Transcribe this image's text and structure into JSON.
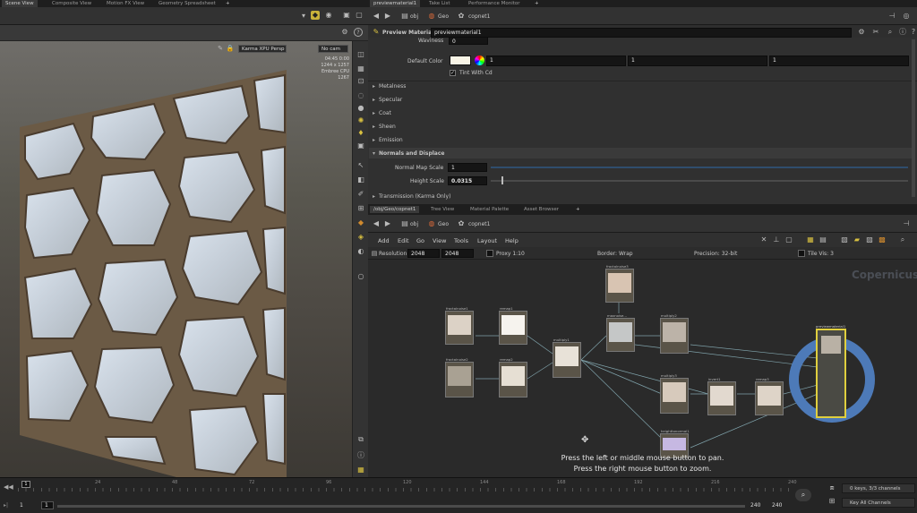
{
  "top_tabs": [
    "Scene View",
    "Composite View",
    "Motion FX View",
    "Geometry Spreadsheet"
  ],
  "viewport": {
    "camera": "Karma XPU Persp",
    "cam_menu": "No cam",
    "stats": [
      "04:45",
      "0:00",
      "1244 x 1257",
      "Embree CPU",
      "1267"
    ]
  },
  "right_top_tabs": [
    "previewmaterial1",
    "Take List",
    "Performance Monitor"
  ],
  "path_top": {
    "root": "obj",
    "geo": "Geo",
    "net": "copnet1"
  },
  "material": {
    "title": "Preview Material",
    "name": "previewmaterial1",
    "waviness_label": "Waviness",
    "waviness": "0",
    "default_color_label": "Default Color",
    "color_values": [
      "1",
      "1",
      "1"
    ],
    "tint_label": "Tint With Cd",
    "sections": [
      "Metalness",
      "Specular",
      "Coat",
      "Sheen",
      "Emission"
    ],
    "normals_section": "Normals and Displace",
    "normal_map_label": "Normal Map Scale",
    "normal_map": "1",
    "height_label": "Height Scale",
    "height": "0.0315",
    "transmission": "Transmission (Karma Only)"
  },
  "net_tabs": [
    "/obj/Geo/copnet1",
    "Tree View",
    "Material Palette",
    "Asset Browser"
  ],
  "path_bottom": {
    "root": "obj",
    "geo": "Geo",
    "net": "copnet1"
  },
  "menu": [
    "Add",
    "Edit",
    "Go",
    "View",
    "Tools",
    "Layout",
    "Help"
  ],
  "res": {
    "label": "Resolution",
    "w": "2048",
    "h": "2048",
    "proxy": "Proxy 1:10",
    "border": "Border: Wrap",
    "precision": "Precision: 32-bit",
    "tile": "Tile Vis: 3"
  },
  "brand": "Copernicus",
  "nodes": {
    "fractalnoise1": "fractalnoise1",
    "fractalnoise2": "fractalnoise2",
    "remap1": "remap1",
    "remap2": "remap2",
    "multiply1": "multiply1",
    "fractalnoise3": "fractalnoise3",
    "maxnoise": "maxnoise...",
    "multiply2": "multiply2",
    "multiply3": "multiply3",
    "invert1": "invert1",
    "remap3": "remap3",
    "heightnormal": "heighttonormal1",
    "output": "previewmaterial1"
  },
  "hint1": "Press the left or middle mouse button to pan.",
  "hint2": "Press the right mouse button to zoom.",
  "timeline": {
    "ticks": [
      "1",
      "24",
      "48",
      "72",
      "96",
      "120",
      "144",
      "168",
      "192",
      "216",
      "240"
    ],
    "start": "1",
    "current": "1",
    "end1": "240",
    "end2": "240",
    "keys": "0 keys, 3/3 channels",
    "all": "Key All Channels"
  }
}
